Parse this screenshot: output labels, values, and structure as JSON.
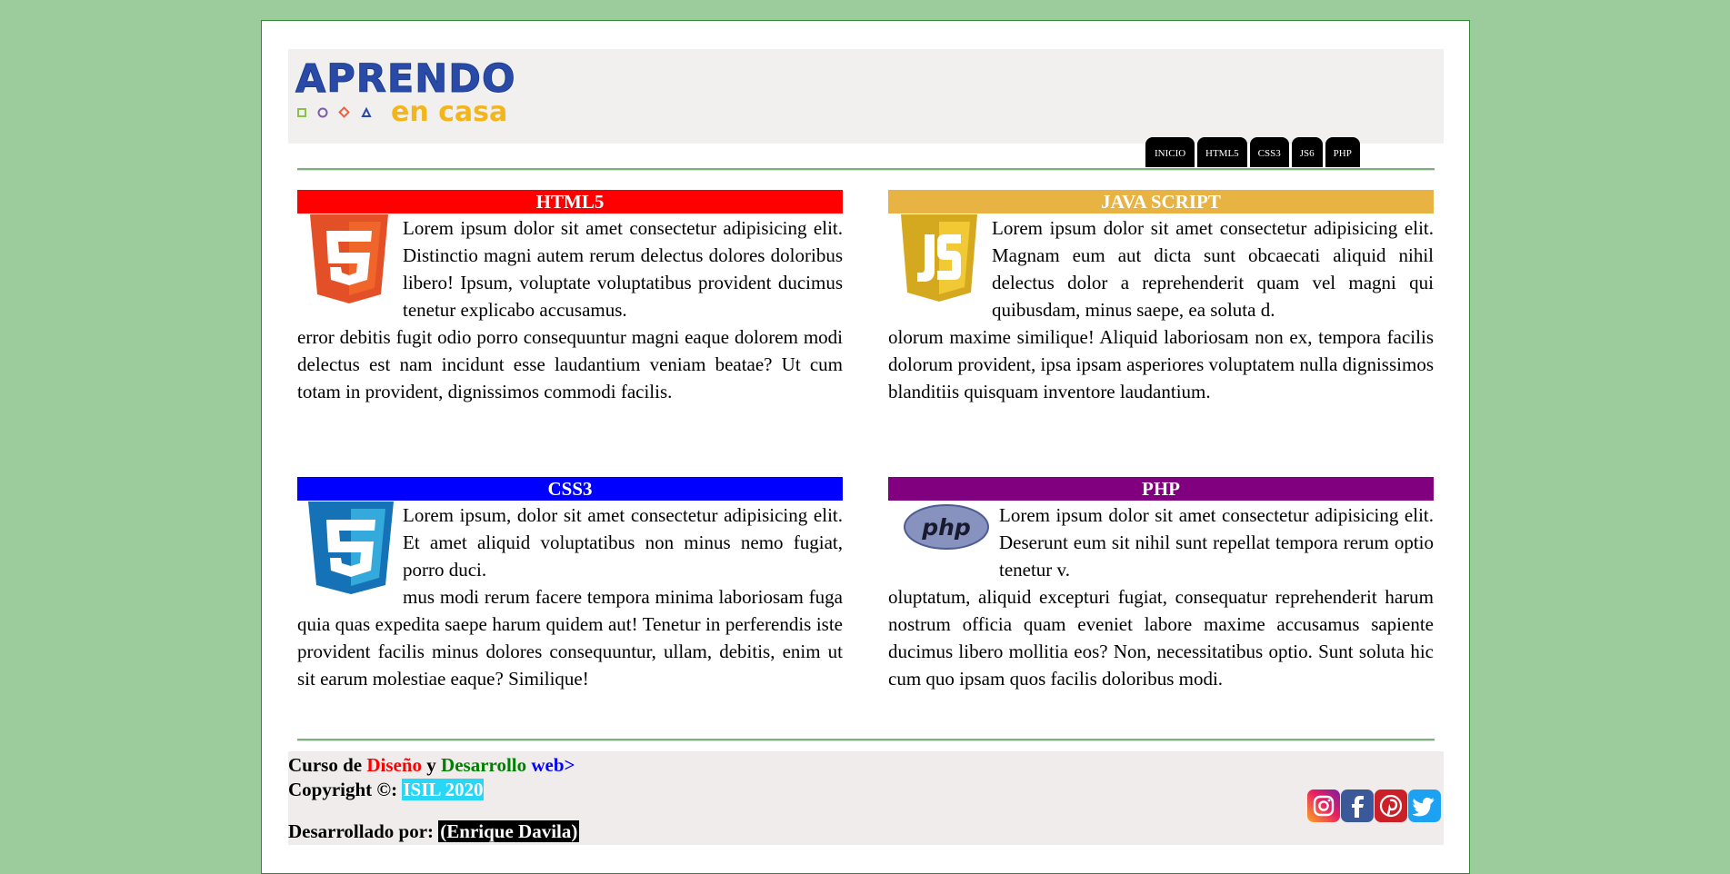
{
  "logo": {
    "main": "APRENDO",
    "sub": "en casa"
  },
  "nav": {
    "items": [
      "INICIO",
      "HTML5",
      "CSS3",
      "JS6",
      "PHP"
    ]
  },
  "sections": [
    {
      "title": "HTML5",
      "color": "#ff0000",
      "icon": "html5-icon",
      "intro": "Lorem ipsum dolor sit amet consectetur adipisicing elit. Distinctio magni autem rerum delectus dolores doloribus libero! Ipsum, voluptate voluptatibus provident ducimus tenetur explicabo accusamus.",
      "body": "error debitis fugit odio porro consequuntur magni eaque dolorem modi delectus est nam incidunt esse laudantium veniam beatae? Ut cum totam in provident, dignissimos commodi facilis."
    },
    {
      "title": "JAVA SCRIPT",
      "color": "#e8b342",
      "icon": "javascript-icon",
      "intro": "Lorem ipsum dolor sit amet consectetur adipisicing elit. Magnam eum aut dicta sunt obcaecati aliquid nihil delectus dolor a reprehenderit quam vel magni qui quibusdam, minus saepe, ea soluta d.",
      "body": "olorum maxime similique! Aliquid laboriosam non ex, tempora facilis dolorum provident, ipsa ipsam asperiores voluptatem nulla dignissimos blanditiis quisquam inventore laudantium."
    },
    {
      "title": "CSS3",
      "color": "#0000ff",
      "icon": "css3-icon",
      "intro": "Lorem ipsum, dolor sit amet consectetur adipisicing elit. Et amet aliquid voluptatibus non minus nemo fugiat, porro duci.",
      "body": "mus modi rerum facere tempora minima laboriosam fuga quia quas expedita saepe harum quidem aut! Tenetur in perferendis iste provident facilis minus dolores consequuntur, ullam, debitis, enim ut sit earum molestiae eaque? Similique!"
    },
    {
      "title": "PHP",
      "color": "#800080",
      "icon": "php-icon",
      "intro": "Lorem ipsum dolor sit amet consectetur adipisicing elit. Deserunt eum sit nihil sunt repellat tempora rerum optio tenetur v.",
      "body": "oluptatum, aliquid excepturi fugiat, consequatur reprehenderit harum nostrum officia quam eveniet labore maxime accusamus sapiente ducimus libero mollitia eos? Non, necessitatibus optio. Sunt soluta hic cum quo ipsam quos facilis doloribus modi."
    }
  ],
  "footer": {
    "curso": "Curso de",
    "diseno": "Diseño",
    "y": "y",
    "desarrollo": "Desarrollo",
    "web": "web>",
    "copyright_label": "Copyright ©:",
    "copyright_value": "ISIL 2020",
    "dev_label": "Desarrollado por:",
    "dev_value": "(Enrique Davila)",
    "colors": {
      "diseno": "#ff0000",
      "desarrollo": "#008000",
      "web": "#0000ff"
    }
  },
  "socials": [
    "instagram-icon",
    "facebook-icon",
    "pinterest-icon",
    "twitter-icon"
  ]
}
